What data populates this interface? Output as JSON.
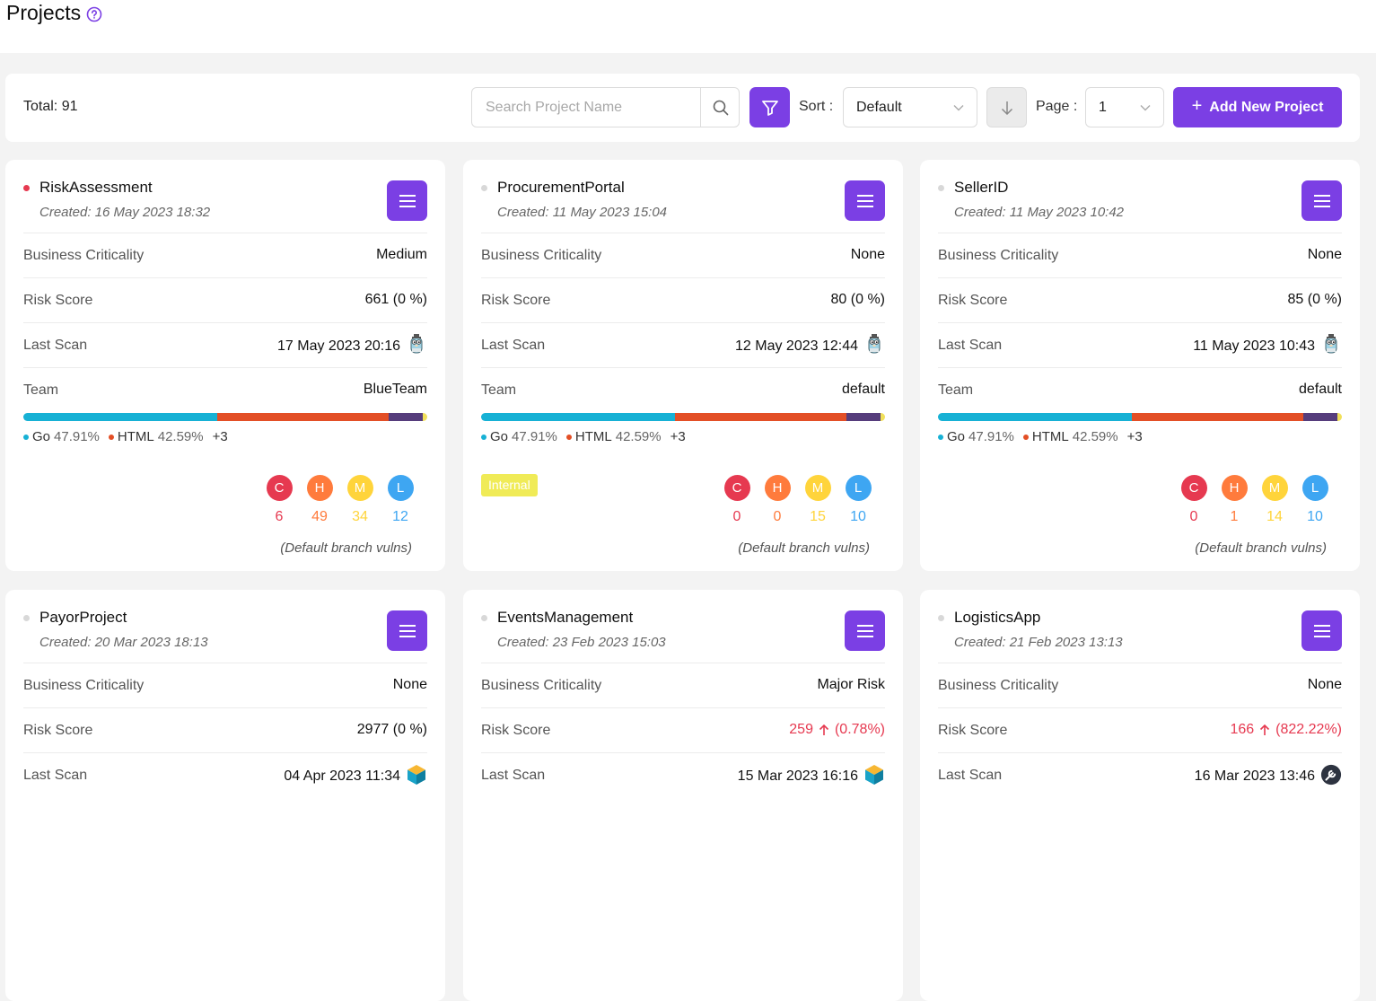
{
  "header": {
    "title": "Projects",
    "help_icon": "question-circle-icon"
  },
  "toolbar": {
    "total": "Total: 91",
    "search_placeholder": "Search Project Name",
    "sort_label": "Sort :",
    "sort_value": "Default",
    "page_label": "Page :",
    "page_value": "1",
    "add_button": "Add New Project"
  },
  "colors": {
    "accent": "#7b3fe4",
    "critical": "#e63950",
    "high": "#ff7b3c",
    "medium": "#ffd43b",
    "low": "#3ea6f2",
    "go": "#17b1d5",
    "html": "#e34f26"
  },
  "labels": {
    "business_criticality": "Business Criticality",
    "risk_score": "Risk Score",
    "last_scan": "Last Scan",
    "team": "Team",
    "vuln_note": "(Default branch vulns)",
    "c": "C",
    "h": "H",
    "m": "M",
    "l": "L"
  },
  "projects": [
    {
      "name": "RiskAssessment",
      "status_color": "#e63950",
      "created": "Created: 16 May 2023 18:32",
      "criticality": "Medium",
      "risk_score": "661 (0 %)",
      "risk_trend": "none",
      "last_scan": "17 May 2023 20:16",
      "scan_icon": "gopher-icon",
      "team": "BlueTeam",
      "lang_go": "Go",
      "lang_go_pct": "47.91%",
      "lang_html": "HTML",
      "lang_html_pct": "42.59%",
      "lang_more": "+3",
      "tag": "",
      "vulns": {
        "c": "6",
        "h": "49",
        "m": "34",
        "l": "12"
      }
    },
    {
      "name": "ProcurementPortal",
      "status_color": "#d8d8d8",
      "created": "Created: 11 May 2023 15:04",
      "criticality": "None",
      "risk_score": "80 (0 %)",
      "risk_trend": "none",
      "last_scan": "12 May 2023 12:44",
      "scan_icon": "gopher-icon",
      "team": "default",
      "lang_go": "Go",
      "lang_go_pct": "47.91%",
      "lang_html": "HTML",
      "lang_html_pct": "42.59%",
      "lang_more": "+3",
      "tag": "Internal",
      "vulns": {
        "c": "0",
        "h": "0",
        "m": "15",
        "l": "10"
      }
    },
    {
      "name": "SellerID",
      "status_color": "#d8d8d8",
      "created": "Created: 11 May 2023 10:42",
      "criticality": "None",
      "risk_score": "85 (0 %)",
      "risk_trend": "none",
      "last_scan": "11 May 2023 10:43",
      "scan_icon": "gopher-icon",
      "team": "default",
      "lang_go": "Go",
      "lang_go_pct": "47.91%",
      "lang_html": "HTML",
      "lang_html_pct": "42.59%",
      "lang_more": "+3",
      "tag": "",
      "vulns": {
        "c": "0",
        "h": "1",
        "m": "14",
        "l": "10"
      }
    },
    {
      "name": "PayorProject",
      "status_color": "#d8d8d8",
      "created": "Created: 20 Mar 2023 18:13",
      "criticality": "None",
      "risk_score": "2977 (0 %)",
      "risk_trend": "none",
      "last_scan": "04 Apr 2023 11:34",
      "scan_icon": "cube-icon"
    },
    {
      "name": "EventsManagement",
      "status_color": "#d8d8d8",
      "created": "Created: 23 Feb 2023 15:03",
      "criticality": "Major Risk",
      "risk_score": "259",
      "risk_change": "(0.78%)",
      "risk_trend": "up",
      "last_scan": "15 Mar 2023 16:16",
      "scan_icon": "cube-icon"
    },
    {
      "name": "LogisticsApp",
      "status_color": "#d8d8d8",
      "created": "Created: 21 Feb 2023 13:13",
      "criticality": "None",
      "risk_score": "166",
      "risk_change": "(822.22%)",
      "risk_trend": "up",
      "last_scan": "16 Mar 2023 13:46",
      "scan_icon": "wrench-badge-icon"
    }
  ]
}
